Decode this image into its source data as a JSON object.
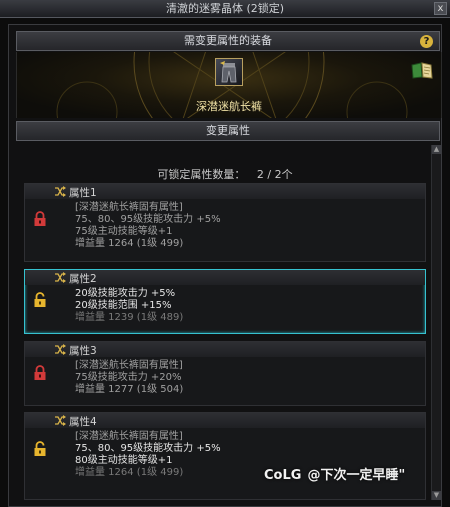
{
  "window": {
    "title": "清澈的迷雾晶体 (2锁定)",
    "close_label": "x"
  },
  "equip_section": {
    "header": "需变更属性的装备",
    "help_label": "?"
  },
  "equipped_item": {
    "name": "深潜迷航长裤"
  },
  "change_section": {
    "header": "变更属性"
  },
  "lock_info": {
    "label": "可锁定属性数量：",
    "value": "2 / 2个"
  },
  "properties": [
    {
      "title": "属性1",
      "lock_color": "#d23a3a",
      "locked": true,
      "selected": false,
      "lines": [
        {
          "text": "[深潜迷航长裤固有属性]",
          "style": "gray"
        },
        {
          "text": "75、80、95级技能攻击力 +5%",
          "style": "gray"
        },
        {
          "text": "75级主动技能等级+1",
          "style": "gray"
        },
        {
          "text": "增益量 1264 (1级 499)",
          "style": "gray"
        }
      ]
    },
    {
      "title": "属性2",
      "lock_color": "#e7b52e",
      "locked": false,
      "selected": true,
      "lines": [
        {
          "text": "20级技能攻击力 +5%",
          "style": "white"
        },
        {
          "text": "20级技能范围 +15%",
          "style": "white"
        },
        {
          "text": "增益量 1239 (1级 489)",
          "style": "dim"
        }
      ]
    },
    {
      "title": "属性3",
      "lock_color": "#d23a3a",
      "locked": true,
      "selected": false,
      "lines": [
        {
          "text": "[深潜迷航长裤固有属性]",
          "style": "gray"
        },
        {
          "text": "75级技能攻击力 +20%",
          "style": "gray"
        },
        {
          "text": "增益量 1277 (1级 504)",
          "style": "gray"
        }
      ]
    },
    {
      "title": "属性4",
      "lock_color": "#e7b52e",
      "locked": false,
      "selected": false,
      "lines": [
        {
          "text": "[深潜迷航长裤固有属性]",
          "style": "gray"
        },
        {
          "text": "75、80、95级技能攻击力 +5%",
          "style": "white"
        },
        {
          "text": "80级主动技能等级+1",
          "style": "white"
        },
        {
          "text": "增益量 1264 (1级 499)",
          "style": "dim"
        }
      ]
    }
  ],
  "watermark": {
    "logo": "CoLG",
    "text": "@下次一定早睡\""
  }
}
